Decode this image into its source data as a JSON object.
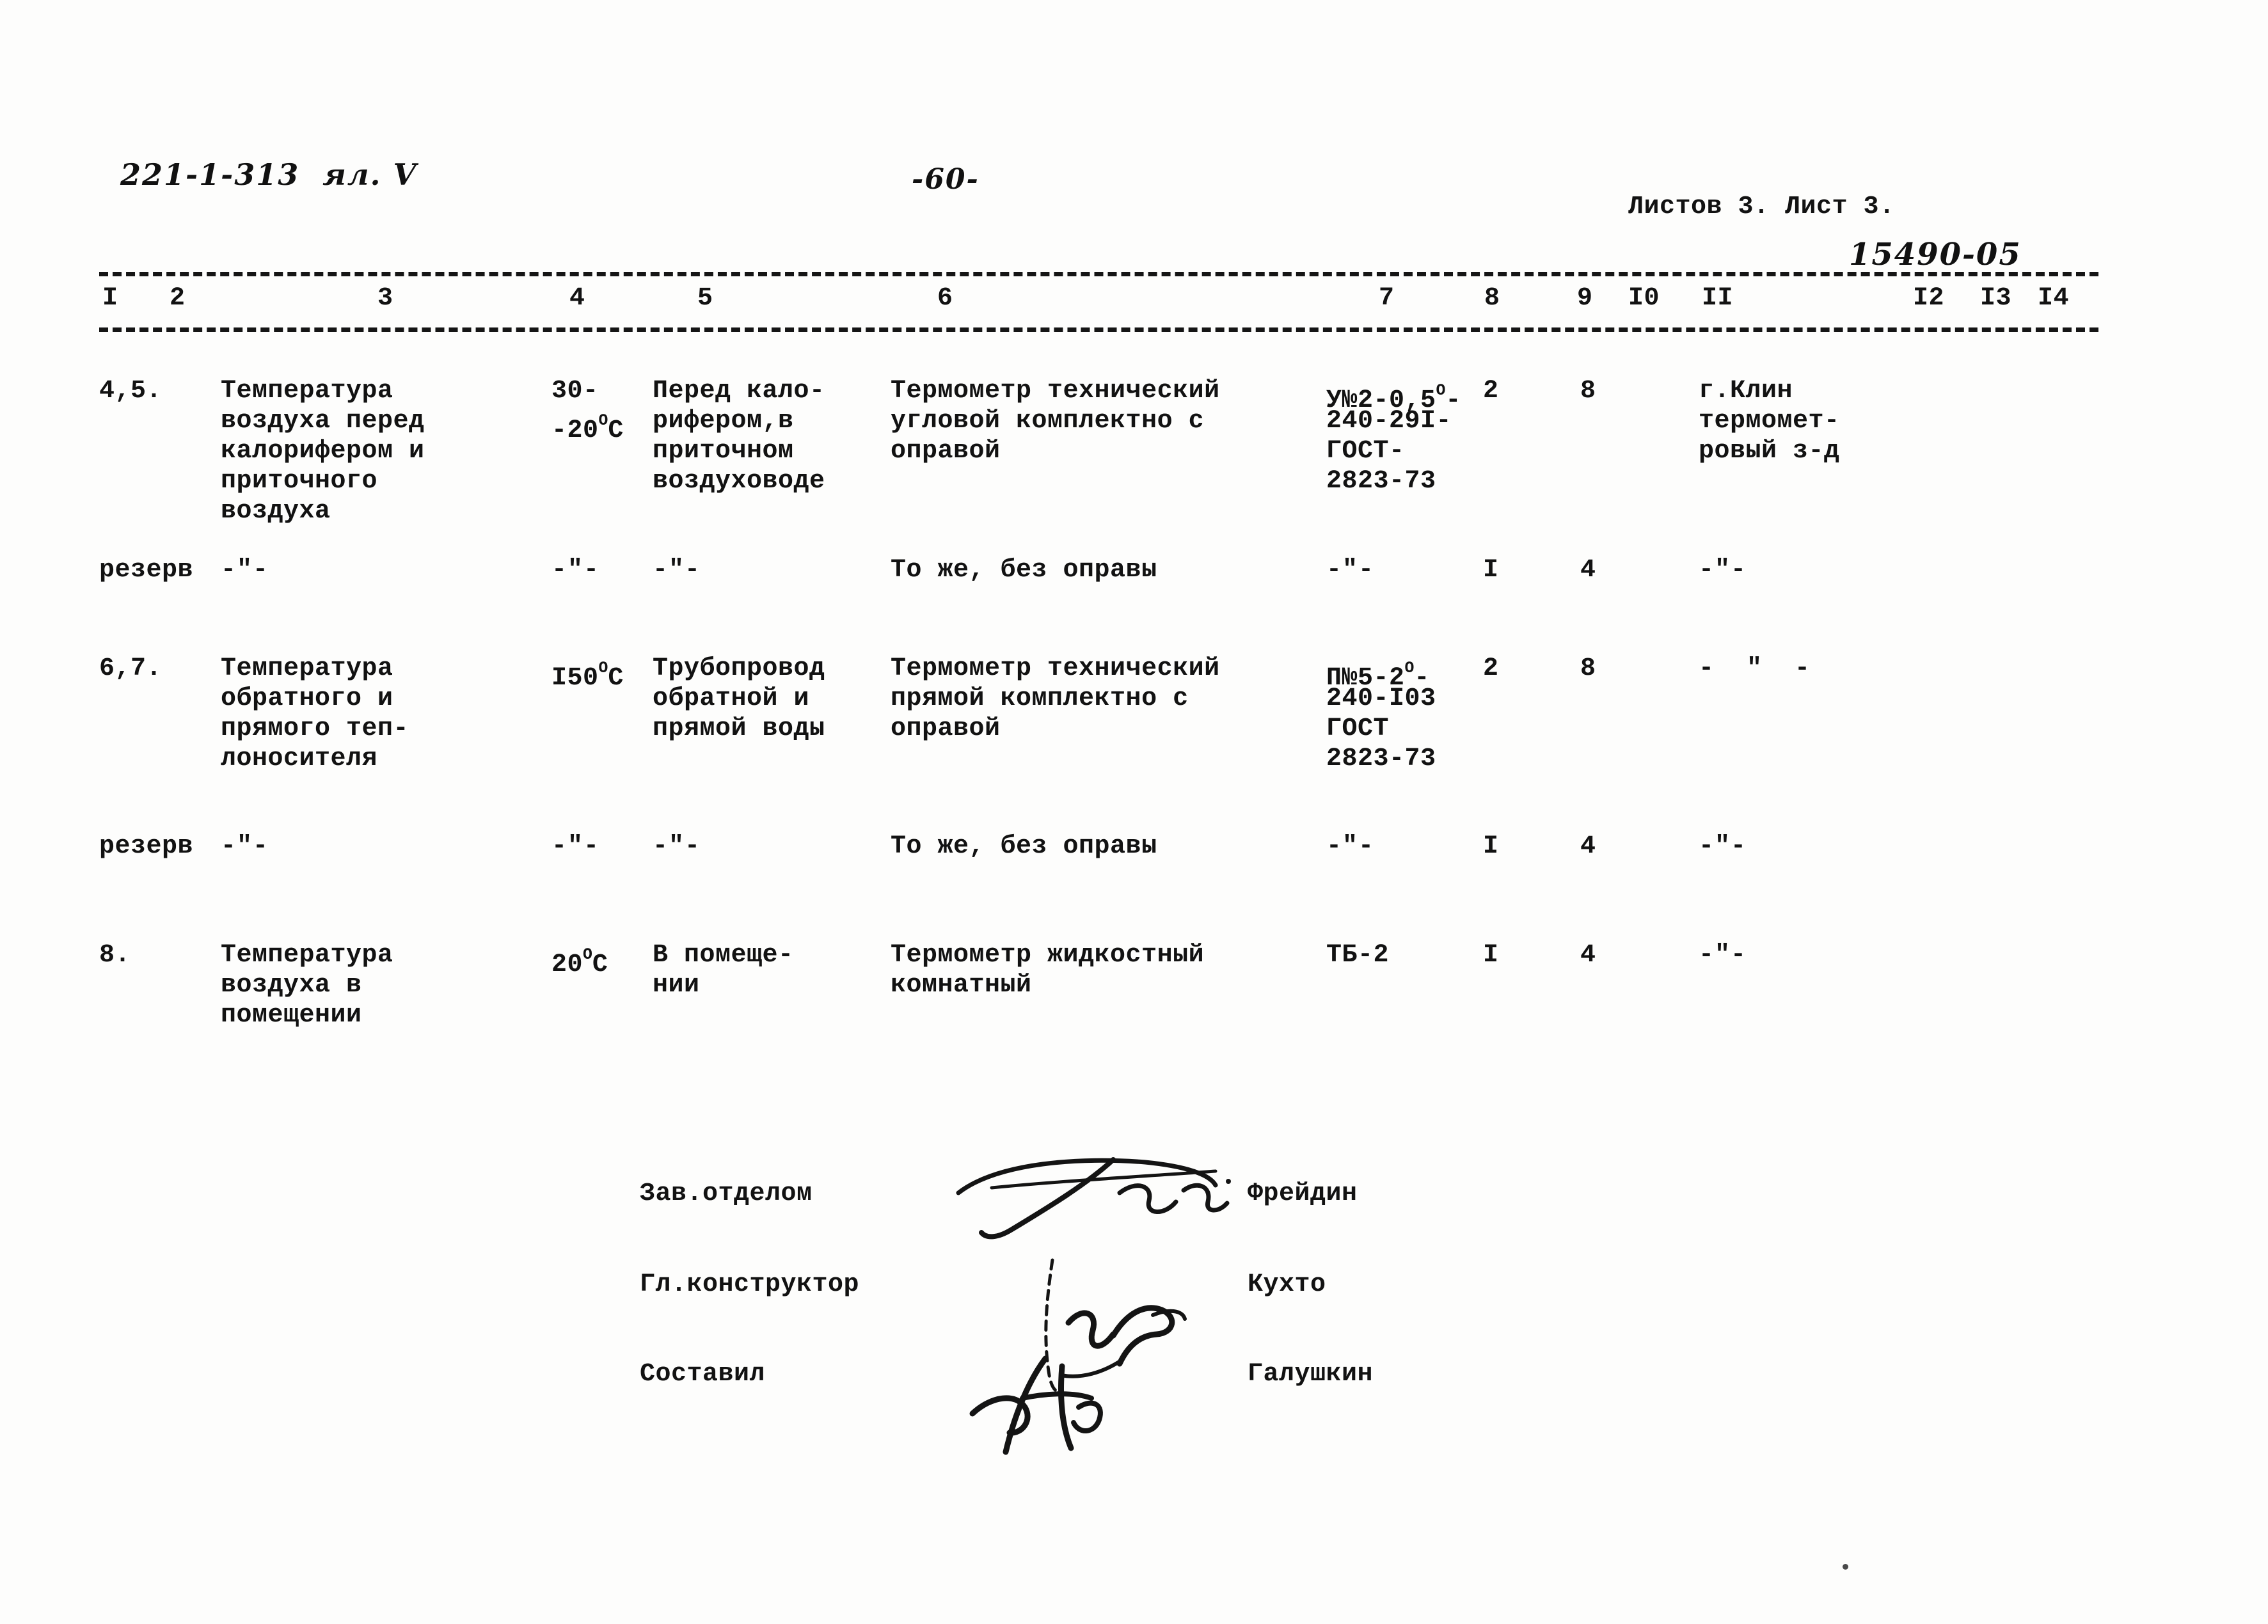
{
  "document": {
    "top_left_code": "221-1-313  ял. V",
    "page_number": "-60-",
    "sheets_label": "Листов 3. Лист 3.",
    "drawing_number": "15490-05"
  },
  "table": {
    "column_numbers": [
      "I",
      "2",
      "3",
      "4",
      "5",
      "6",
      "7",
      "8",
      "9",
      "I0",
      "II",
      "I2",
      "I3",
      "I4"
    ],
    "rows": [
      {
        "c1": "4,5.",
        "c3": [
          "Температура",
          "воздуха перед",
          "калорифером и",
          "приточного",
          "воздуха"
        ],
        "c4": [
          "30-",
          "-20°C"
        ],
        "c5": [
          "Перед кало-",
          "рифером,в",
          "приточном",
          "воздуховоде"
        ],
        "c6": [
          "Термометр технический",
          "угловой комплектно с",
          "оправой"
        ],
        "c7": [
          "У№2-0,5°-",
          "240-29I-",
          "ГОСТ-",
          "2823-73"
        ],
        "c8": "2",
        "c9": "8",
        "c11": [
          "г.Клин",
          "термомет-",
          "ровый з-д"
        ]
      },
      {
        "c1": "резерв",
        "c3": "-\"-",
        "c4": "-\"-",
        "c5": "-\"-",
        "c6": "То же, без оправы",
        "c7": "-\"-",
        "c8": "I",
        "c9": "4",
        "c11": "-\"-"
      },
      {
        "c1": "6,7.",
        "c3": [
          "Температура",
          "обратного и",
          "прямого теп-",
          "лоносителя"
        ],
        "c4": [
          "I50°C"
        ],
        "c5": [
          "Трубопровод",
          "обратной и",
          "прямой воды"
        ],
        "c6": [
          "Термометр технический",
          "прямой комплектно с",
          "оправой"
        ],
        "c7": [
          "П№5-2°-",
          "240-I03",
          "ГОСТ",
          "2823-73"
        ],
        "c8": "2",
        "c9": "8",
        "c11": "-  \"  -"
      },
      {
        "c1": "резерв",
        "c3": "-\"-",
        "c4": "-\"-",
        "c5": "-\"-",
        "c6": "То же, без оправы",
        "c7": "-\"-",
        "c8": "I",
        "c9": "4",
        "c11": "-\"-"
      },
      {
        "c1": "8.",
        "c3": [
          "Температура",
          "воздуха в",
          "помещении"
        ],
        "c4": [
          "20°C"
        ],
        "c5": [
          "В помеще-",
          "нии"
        ],
        "c6": [
          "Термометр жидкостный",
          "комнатный"
        ],
        "c7": [
          "ТБ-2"
        ],
        "c8": "I",
        "c9": "4",
        "c11": "-\"-"
      }
    ]
  },
  "signatures": [
    {
      "role": "Зав.отделом",
      "name": "Фрейдин"
    },
    {
      "role": "Гл.конструктор",
      "name": "Кухто"
    },
    {
      "role": "Составил",
      "name": "Галушкин"
    }
  ]
}
